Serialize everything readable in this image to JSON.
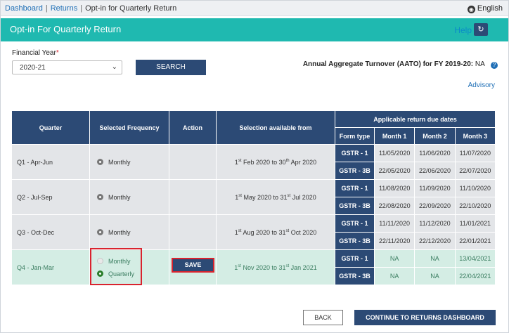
{
  "breadcrumb": {
    "items": [
      "Dashboard",
      "Returns"
    ],
    "current": "Opt-in for Quarterly Return"
  },
  "language": "English",
  "header": {
    "title": "Opt-in For Quarterly Return",
    "help": "Help",
    "refresh_icon": "refresh-icon"
  },
  "form": {
    "fy_label": "Financial Year",
    "required_mark": "*",
    "fy_value": "2020-21",
    "search_label": "SEARCH",
    "aato_label": "Annual Aggregate Turnover (AATO) for FY 2019-20:",
    "aato_value": "NA",
    "advisory": "Advisory"
  },
  "table": {
    "headers": {
      "quarter": "Quarter",
      "frequency": "Selected Frequency",
      "action": "Action",
      "available": "Selection available from",
      "due_dates": "Applicable return due dates",
      "form_type": "Form type",
      "month1": "Month 1",
      "month2": "Month 2",
      "month3": "Month 3"
    },
    "rows": [
      {
        "quarter": "Q1 - Apr-Jun",
        "frequency": "Monthly",
        "available": {
          "d1": "1",
          "s1": "st",
          "t1": " Feb 2020 to 30",
          "s2": "th",
          "t2": " Apr 2020"
        },
        "r1": {
          "form": "GSTR - 1",
          "m1": "11/05/2020",
          "m2": "11/06/2020",
          "m3": "11/07/2020"
        },
        "r2": {
          "form": "GSTR - 3B",
          "m1": "22/05/2020",
          "m2": "22/06/2020",
          "m3": "22/07/2020"
        }
      },
      {
        "quarter": "Q2 - Jul-Sep",
        "frequency": "Monthly",
        "available": {
          "d1": "1",
          "s1": "st",
          "t1": " May 2020 to 31",
          "s2": "st",
          "t2": " Jul 2020"
        },
        "r1": {
          "form": "GSTR - 1",
          "m1": "11/08/2020",
          "m2": "11/09/2020",
          "m3": "11/10/2020"
        },
        "r2": {
          "form": "GSTR - 3B",
          "m1": "22/08/2020",
          "m2": "22/09/2020",
          "m3": "22/10/2020"
        }
      },
      {
        "quarter": "Q3 - Oct-Dec",
        "frequency": "Monthly",
        "available": {
          "d1": "1",
          "s1": "st",
          "t1": " Aug 2020 to 31",
          "s2": "st",
          "t2": " Oct 2020"
        },
        "r1": {
          "form": "GSTR - 1",
          "m1": "11/11/2020",
          "m2": "11/12/2020",
          "m3": "11/01/2021"
        },
        "r2": {
          "form": "GSTR - 3B",
          "m1": "22/11/2020",
          "m2": "22/12/2020",
          "m3": "22/01/2021"
        }
      },
      {
        "quarter": "Q4 - Jan-Mar",
        "frequency_options": [
          "Monthly",
          "Quarterly"
        ],
        "frequency_selected": "Quarterly",
        "save_label": "SAVE",
        "available": {
          "d1": "1",
          "s1": "st",
          "t1": " Nov 2020 to 31",
          "s2": "st",
          "t2": " Jan 2021"
        },
        "r1": {
          "form": "GSTR - 1",
          "m1": "NA",
          "m2": "NA",
          "m3": "13/04/2021"
        },
        "r2": {
          "form": "GSTR - 3B",
          "m1": "NA",
          "m2": "NA",
          "m3": "22/04/2021"
        }
      }
    ]
  },
  "footer": {
    "back": "BACK",
    "continue": "CONTINUE TO RETURNS DASHBOARD"
  },
  "colors": {
    "header_teal": "#1fb9b0",
    "navy": "#2c4a75",
    "row_grey": "#e3e5e8",
    "row_green": "#d4ede4",
    "highlight_red": "#d9232e"
  }
}
